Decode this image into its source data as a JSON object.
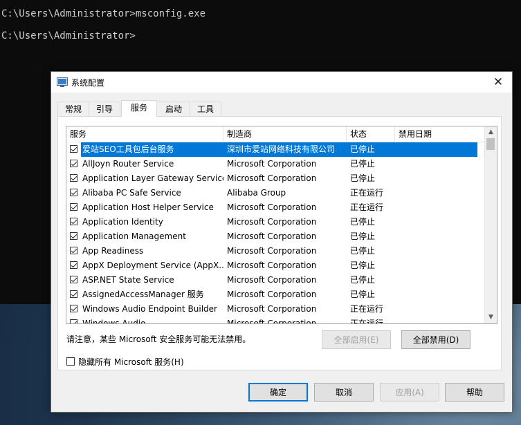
{
  "console": {
    "line1": "C:\\Users\\Administrator>msconfig.exe",
    "line2": "C:\\Users\\Administrator>"
  },
  "dialog": {
    "title": "系统配置",
    "tabs": [
      {
        "label": "常规"
      },
      {
        "label": "引导"
      },
      {
        "label": "服务",
        "active": true
      },
      {
        "label": "启动"
      },
      {
        "label": "工具"
      }
    ],
    "columns": [
      "服务",
      "制造商",
      "状态",
      "禁用日期"
    ],
    "services": [
      {
        "name": "爱站SEO工具包后台服务",
        "manufacturer": "深圳市爱站网络科技有限公司",
        "status": "已停止",
        "checked": true,
        "selected": true
      },
      {
        "name": "AllJoyn Router Service",
        "manufacturer": "Microsoft Corporation",
        "status": "已停止",
        "checked": true
      },
      {
        "name": "Application Layer Gateway Service",
        "manufacturer": "Microsoft Corporation",
        "status": "已停止",
        "checked": true
      },
      {
        "name": "Alibaba PC Safe Service",
        "manufacturer": "Alibaba Group",
        "status": "正在运行",
        "checked": true
      },
      {
        "name": "Application Host Helper Service",
        "manufacturer": "Microsoft Corporation",
        "status": "正在运行",
        "checked": true
      },
      {
        "name": "Application Identity",
        "manufacturer": "Microsoft Corporation",
        "status": "已停止",
        "checked": true
      },
      {
        "name": "Application Management",
        "manufacturer": "Microsoft Corporation",
        "status": "已停止",
        "checked": true
      },
      {
        "name": "App Readiness",
        "manufacturer": "Microsoft Corporation",
        "status": "已停止",
        "checked": true
      },
      {
        "name": "AppX Deployment Service (AppX...",
        "manufacturer": "Microsoft Corporation",
        "status": "已停止",
        "checked": true
      },
      {
        "name": "ASP.NET State Service",
        "manufacturer": "Microsoft Corporation",
        "status": "已停止",
        "checked": true
      },
      {
        "name": "AssignedAccessManager 服务",
        "manufacturer": "Microsoft Corporation",
        "status": "已停止",
        "checked": true
      },
      {
        "name": "Windows Audio Endpoint Builder",
        "manufacturer": "Microsoft Corporation",
        "status": "正在运行",
        "checked": true
      },
      {
        "name": "Windows Audio",
        "manufacturer": "Microsoft Corporation",
        "status": "正在运行",
        "checked": true
      }
    ],
    "notice": "请注意，某些 Microsoft 安全服务可能无法禁用。",
    "enable_all": "全部启用(E)",
    "disable_all": "全部禁用(D)",
    "hide_ms_label": "隐藏所有 Microsoft 服务(H)",
    "ok": "确定",
    "cancel": "取消",
    "apply": "应用(A)",
    "help": "帮助"
  },
  "colors": {
    "selection": "#0078d7",
    "console_bg": "#0c0c0c"
  }
}
